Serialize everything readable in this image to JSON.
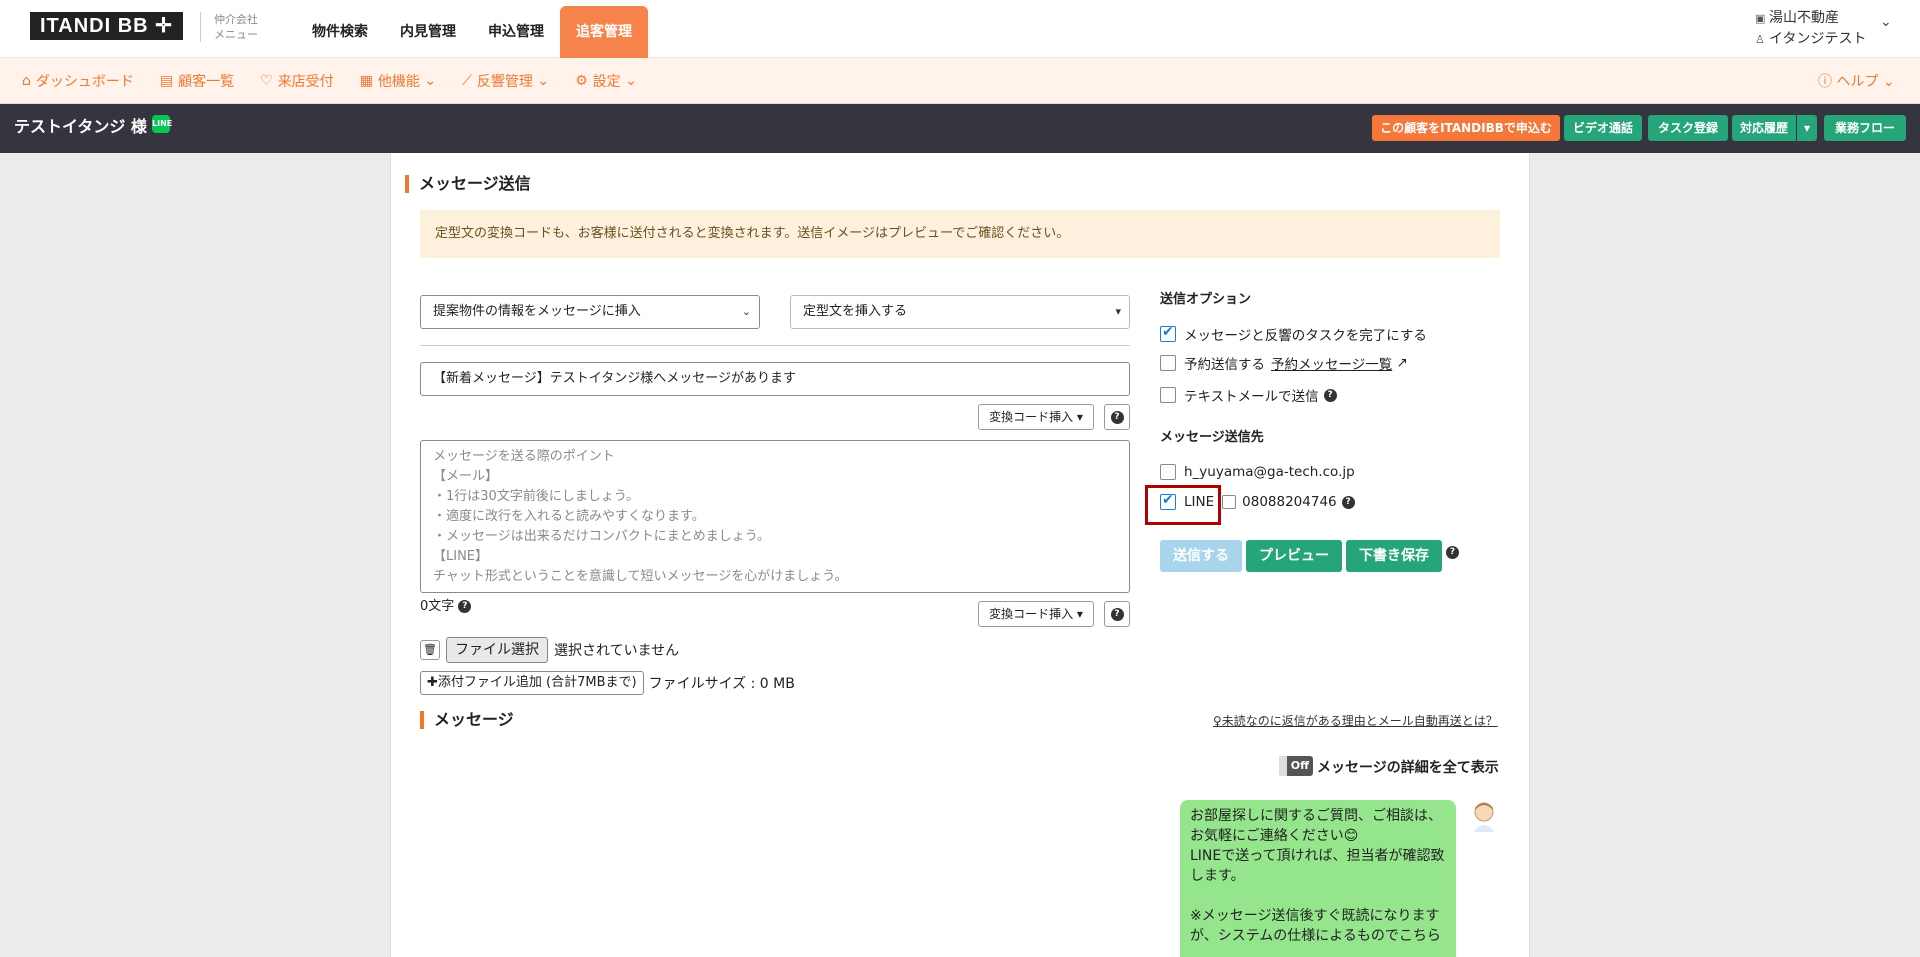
{
  "header": {
    "logo": "ITANDI BB ✛",
    "broker_menu_line1": "仲介会社",
    "broker_menu_line2": "メニュー",
    "nav": [
      "物件検索",
      "内見管理",
      "申込管理",
      "追客管理"
    ],
    "active_nav": "追客管理",
    "company": "湯山不動産",
    "user": "イタンジテスト"
  },
  "subnav": {
    "items": [
      {
        "label": "ダッシュボード",
        "icon": "home-icon"
      },
      {
        "label": "顧客一覧",
        "icon": "document-icon"
      },
      {
        "label": "来店受付",
        "icon": "handshake-icon"
      },
      {
        "label": "他機能",
        "icon": "grid-icon"
      },
      {
        "label": "反響管理",
        "icon": "chart-icon"
      },
      {
        "label": "設定",
        "icon": "gear-icon"
      }
    ],
    "help": "ヘルプ"
  },
  "customer_bar": {
    "name": "テストイタンジ 様",
    "line_badge": "LINE",
    "buttons": {
      "apply": "この顧客をITANDIBBで申込む",
      "video": "ビデオ通話",
      "task": "タスク登録",
      "history": "対応履歴",
      "flow": "業務フロー"
    }
  },
  "compose": {
    "title": "メッセージ送信",
    "notice": "定型文の変換コードも、お客様に送付されると変換されます。送信イメージはプレビューでご確認ください。",
    "property_select": "提案物件の情報をメッセージに挿入",
    "template_select": "定型文を挿入する",
    "subject": "【新着メッセージ】テストイタンジ様へメッセージがあります",
    "insert_code_label": "変換コード挿入",
    "placeholder_lines": [
      "メッセージを送る際のポイント",
      "【メール】",
      "・1行は30文字前後にしましょう。",
      "・適度に改行を入れると読みやすくなります。",
      "・メッセージは出来るだけコンパクトにまとめましょう。",
      "【LINE】",
      "チャット形式ということを意識して短いメッセージを心がけましょう。"
    ],
    "char_count": "0文字",
    "file_button": "ファイル選択",
    "file_status": "選択されていません",
    "attach_button": "添付ファイル追加 (合計7MBまで)",
    "file_size": "ファイルサイズ : 0 MB"
  },
  "options": {
    "heading": "送信オプション",
    "complete_task": {
      "label": "メッセージと反響のタスクを完了にする",
      "checked": true
    },
    "scheduled": {
      "label": "予約送信する",
      "link": "予約メッセージ一覧",
      "checked": false
    },
    "text_mail": {
      "label": "テキストメールで送信",
      "checked": false
    },
    "dest_heading": "メッセージ送信先",
    "email": {
      "label": "h_yuyama@ga-tech.co.jp",
      "checked": false
    },
    "line": {
      "label": "LINE",
      "checked": true
    },
    "phone": {
      "label": "08088204746",
      "checked": false
    },
    "send": "送信する",
    "preview": "プレビュー",
    "draft": "下書き保存"
  },
  "messages": {
    "title": "メッセージ",
    "unread_link": "未読なのに返信がある理由とメール自動再送とは？",
    "toggle": "Off",
    "toggle_label": "メッセージの詳細を全て表示",
    "bubble_lines": [
      "お部屋探しに関するご質問、ご相談は、",
      "お気軽にご連絡ください😊",
      "LINEで送って頂ければ、担当者が確認致",
      "します。",
      "",
      "※メッセージ送信後すぐ既読になります",
      "が、システムの仕様によるものでこちら"
    ]
  },
  "colors": {
    "accent": "#f27830",
    "teal": "#26a57a",
    "dark_bar": "#35353f",
    "bubble": "#94e58c"
  }
}
